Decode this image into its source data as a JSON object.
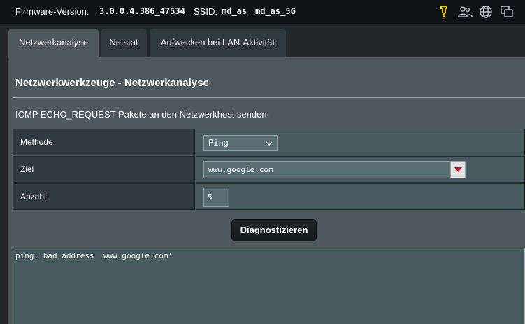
{
  "topbar": {
    "firmware_label": "Firmware-Version:",
    "firmware_value": "3.0.0.4.386_47534",
    "ssid_label": "SSID:",
    "ssid_1": "md_as",
    "ssid_2": "md_as_5G",
    "icons": [
      "usb-icon",
      "clients-icon",
      "internet-icon",
      "apps-icon"
    ],
    "usb_color": "#f5d000"
  },
  "tabs": [
    {
      "label": "Netzwerkanalyse",
      "active": true
    },
    {
      "label": "Netstat",
      "active": false
    },
    {
      "label": "Aufwecken bei LAN-Aktivität",
      "active": false
    }
  ],
  "panel": {
    "title": "Netzwerkwerkzeuge - Netzwerkanalyse",
    "description": "ICMP ECHO_REQUEST-Pakete an den Netzwerkhost senden.",
    "fields": {
      "method_label": "Methode",
      "method_value": "Ping",
      "target_label": "Ziel",
      "target_value": "www.google.com",
      "count_label": "Anzahl",
      "count_value": "5"
    },
    "button_label": "Diagnostizieren",
    "output": "ping: bad address 'www.google.com'"
  },
  "colors": {
    "panel_bg": "#4d595d",
    "label_cell_bg": "#2f3a3e",
    "dropdown_arrow": "#c8102e"
  }
}
